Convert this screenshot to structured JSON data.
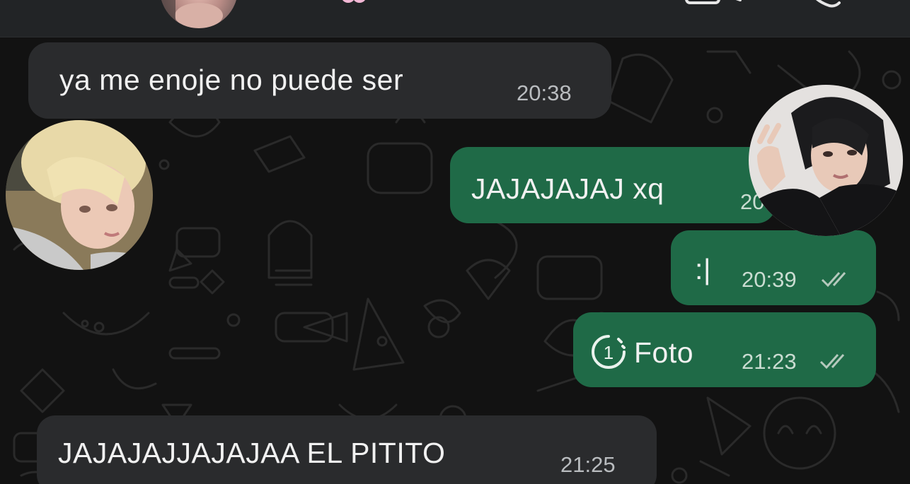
{
  "header": {
    "back_icon": "back-arrow-icon",
    "avatar": "contact-avatar",
    "name_emoji": "cherry-blossom-icon",
    "video_icon": "video-call-icon",
    "call_icon": "phone-call-icon"
  },
  "messages": [
    {
      "direction": "in",
      "text": "ya me enoje no puede ser",
      "time": "20:38"
    },
    {
      "direction": "out",
      "text": "JAJAJAJAJ xq",
      "time": "20:38"
    },
    {
      "direction": "out",
      "text": ":|",
      "time": "20:39",
      "status": "double-check-icon"
    },
    {
      "direction": "out",
      "text": "Foto",
      "time": "21:23",
      "status": "double-check-icon",
      "media_icon": "view-once-icon",
      "view_once_count": "1"
    },
    {
      "direction": "in",
      "text": "JAJAJAJJAJAJAA EL PITITO",
      "time": "21:25"
    }
  ],
  "colors": {
    "incoming_bubble": "#2a2b2d",
    "outgoing_bubble": "#1f6a47",
    "wallpaper": "#121212",
    "header": "#222426"
  },
  "overlays": {
    "left_avatar": "blonde-person-photo",
    "right_avatar": "dark-haired-person-photo"
  }
}
